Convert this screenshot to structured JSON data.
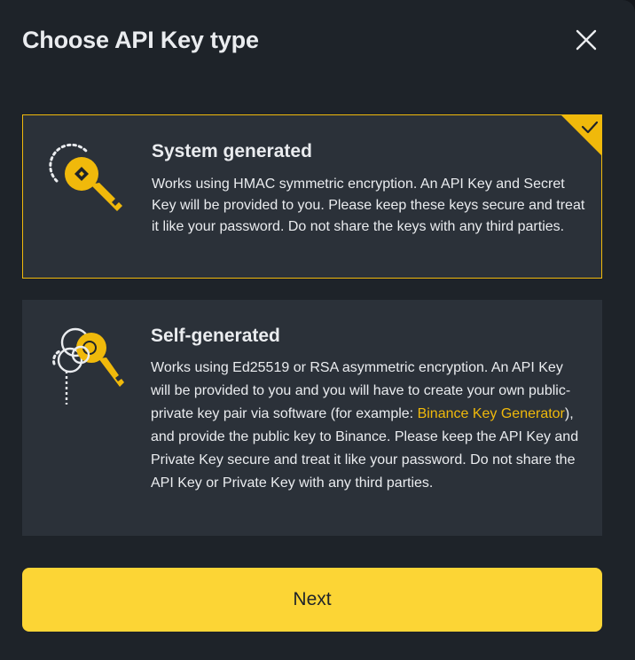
{
  "dialog": {
    "title": "Choose API Key type",
    "close_icon": "close-icon"
  },
  "options": [
    {
      "title": "System generated",
      "description": "Works using HMAC symmetric encryption. An API Key and Secret Key will be provided to you. Please keep these keys secure and treat it like your password. Do not share the keys with any third parties.",
      "selected": true,
      "icon": "key-icon"
    },
    {
      "title": "Self-generated",
      "description_before_link": "Works using Ed25519 or RSA asymmetric encryption. An API Key will be provided to you and you will have to create your own public-private key pair via software (for example: ",
      "link_text": "Binance Key Generator",
      "description_after_link": "), and provide the public key to Binance. Please keep the API Key and Private Key secure and treat it like your password. Do not share the API Key or Private Key with any third parties.",
      "selected": false,
      "icon": "key-pair-icon"
    }
  ],
  "next_button": {
    "label": "Next"
  },
  "colors": {
    "accent": "#F0B90B",
    "button": "#FCD535",
    "background": "#1E2329",
    "card": "#2B3139",
    "text": "#EAECEF"
  }
}
